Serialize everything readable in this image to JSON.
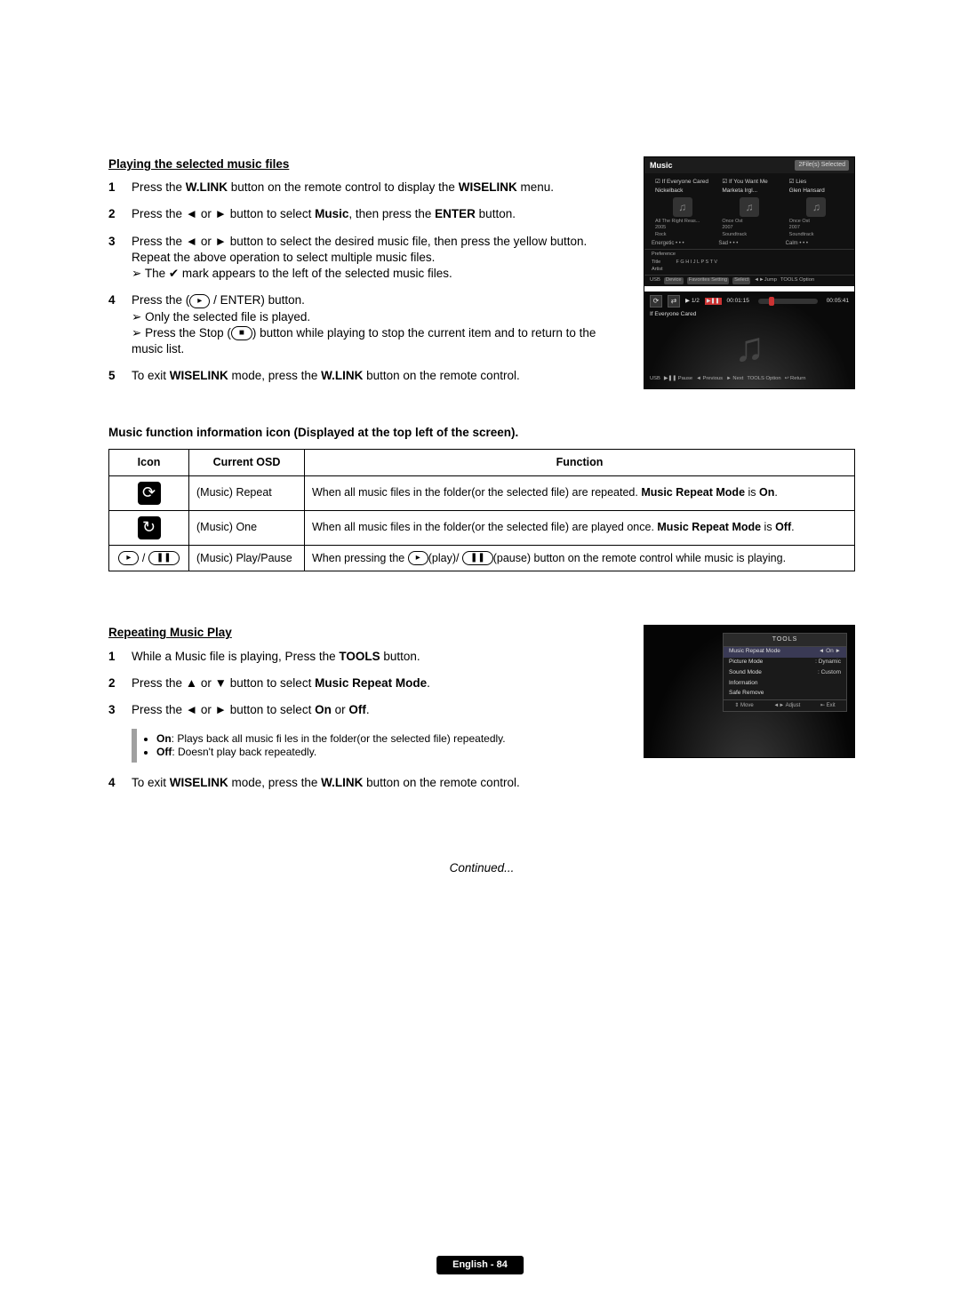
{
  "section1": {
    "title": "Playing the selected music files",
    "steps": [
      {
        "n": "1",
        "parts": [
          {
            "t": "Press the "
          },
          {
            "b": "W.LINK"
          },
          {
            "t": " button on the remote control to display the "
          },
          {
            "b": "WISELINK"
          },
          {
            "t": " menu."
          }
        ]
      },
      {
        "n": "2",
        "parts": [
          {
            "t": "Press the ◄ or ► button to select "
          },
          {
            "b": "Music"
          },
          {
            "t": ", then press the "
          },
          {
            "b": "ENTER"
          },
          {
            "t": " button."
          }
        ]
      },
      {
        "n": "3",
        "lines": [
          {
            "parts": [
              {
                "t": "Press the ◄ or ► button to select the desired music file, then press the yellow button."
              }
            ]
          },
          {
            "parts": [
              {
                "t": "Repeat the above operation to select multiple music files."
              }
            ]
          },
          {
            "arrow": true,
            "parts": [
              {
                "t": "The "
              },
              {
                "chk": true
              },
              {
                "t": " mark appears to the left of the selected music files."
              }
            ]
          }
        ]
      },
      {
        "n": "4",
        "lines": [
          {
            "parts": [
              {
                "t": "Press the ("
              },
              {
                "icon": "▸"
              },
              {
                "t": " / ENTER) button."
              }
            ]
          },
          {
            "arrow": true,
            "parts": [
              {
                "t": "Only the selected file is played."
              }
            ]
          },
          {
            "arrow": true,
            "parts": [
              {
                "t": "Press the Stop ("
              },
              {
                "icon": "■"
              },
              {
                "t": ") button while playing to stop the current item and to return to the music list."
              }
            ]
          }
        ]
      },
      {
        "n": "5",
        "parts": [
          {
            "t": "To exit "
          },
          {
            "b": "WISELINK"
          },
          {
            "t": " mode, press the "
          },
          {
            "b": "W.LINK"
          },
          {
            "t": " button on the remote control."
          }
        ]
      }
    ]
  },
  "tableHeading": "Music function information icon (Displayed at the top left of the screen).",
  "table": {
    "headers": {
      "icon": "Icon",
      "osd": "Current OSD",
      "fn": "Function"
    },
    "rows": [
      {
        "iconGlyph": "⟳",
        "osd": "(Music) Repeat",
        "fn": [
          {
            "t": "When all music files in the folder(or the selected file) are repeated. "
          },
          {
            "b": "Music Repeat Mode"
          },
          {
            "t": " is "
          },
          {
            "b": "On"
          },
          {
            "t": "."
          }
        ]
      },
      {
        "iconGlyph": "↻",
        "osd": "(Music) One",
        "fn": [
          {
            "t": "When all music files in the folder(or the selected file) are played once. "
          },
          {
            "b": "Music Repeat Mode"
          },
          {
            "t": " is "
          },
          {
            "b": "Off"
          },
          {
            "t": "."
          }
        ]
      },
      {
        "iconPair": [
          "▸",
          "❚❚"
        ],
        "osd": "(Music) Play/Pause",
        "fn": [
          {
            "t": "When pressing the "
          },
          {
            "icon": "▸"
          },
          {
            "t": "(play)/ "
          },
          {
            "icon": "❚❚"
          },
          {
            "t": "(pause) button on the remote control while music is playing."
          }
        ]
      }
    ]
  },
  "section2": {
    "title": "Repeating Music Play",
    "steps": [
      {
        "n": "1",
        "parts": [
          {
            "t": "While a Music file is playing, Press the "
          },
          {
            "b": "TOOLS"
          },
          {
            "t": " button."
          }
        ]
      },
      {
        "n": "2",
        "parts": [
          {
            "t": "Press the ▲ or ▼ button to select "
          },
          {
            "b": "Music Repeat Mode"
          },
          {
            "t": "."
          }
        ]
      },
      {
        "n": "3",
        "parts": [
          {
            "t": "Press the ◄ or ► button to select "
          },
          {
            "b": "On"
          },
          {
            "t": " or "
          },
          {
            "b": "Off"
          },
          {
            "t": "."
          }
        ]
      }
    ],
    "notes": [
      [
        {
          "b": "On"
        },
        {
          "t": ": Plays back all music fi les in the folder(or the selected file) repeatedly."
        }
      ],
      [
        {
          "b": "Off"
        },
        {
          "t": ": Doesn't play back repeatedly."
        }
      ]
    ],
    "step4": {
      "n": "4",
      "parts": [
        {
          "t": "To exit "
        },
        {
          "b": "WISELINK"
        },
        {
          "t": " mode, press the "
        },
        {
          "b": "W.LINK"
        },
        {
          "t": " button on the remote control."
        }
      ]
    }
  },
  "screenshot1": {
    "title": "Music",
    "badge": "2File(s) Selected",
    "tiles": [
      {
        "name": "If Everyone Cared",
        "artist": "Nickelback",
        "album": "All The Right Reas...",
        "year": "2005",
        "genre": "Rock"
      },
      {
        "name": "If You Want Me",
        "artist": "Marketa Irgl...",
        "album": "Once Ost",
        "year": "2007",
        "genre": "Soundtrack"
      },
      {
        "name": "Lies",
        "artist": "Glen Hansard",
        "album": "Once Ost",
        "year": "2007",
        "genre": "Soundtrack"
      }
    ],
    "moods": [
      "Energetic",
      "Sad",
      "Calm"
    ],
    "pref": "Preference",
    "alphaTitle": "Title",
    "alphaArtist": "Artist",
    "alpha": "F   G   H   I   J   L   P   S   T   V",
    "bottombar": {
      "src": "USB",
      "device": "Device",
      "fav": "Favorites Setting",
      "sel": "Select",
      "jump": "◄►Jump",
      "opt": "TOOLS Option"
    },
    "player": {
      "page": "1/2",
      "t1": "00:01:15",
      "t2": "00:05:41",
      "song": "If Everyone Cared",
      "legend": {
        "src": "USB",
        "pause": "▶❚❚ Pause",
        "prev": "◄ Previous",
        "next": "► Next",
        "opt": "TOOLS Option",
        "ret": "↩ Return"
      }
    }
  },
  "screenshot2": {
    "title": "TOOLS",
    "rows": [
      {
        "label": "Music Repeat Mode",
        "val": "◄   On   ►",
        "sel": true
      },
      {
        "label": "Picture Mode",
        "sep": ":",
        "val": "Dynamic"
      },
      {
        "label": "Sound Mode",
        "sep": ":",
        "val": "Custom"
      },
      {
        "label": "Information",
        "val": ""
      },
      {
        "label": "Safe Remove",
        "val": ""
      }
    ],
    "footer": {
      "move": "⇕ Move",
      "adjust": "◄► Adjust",
      "exit": "⇤ Exit"
    }
  },
  "continued": "Continued...",
  "footer": "English - 84"
}
